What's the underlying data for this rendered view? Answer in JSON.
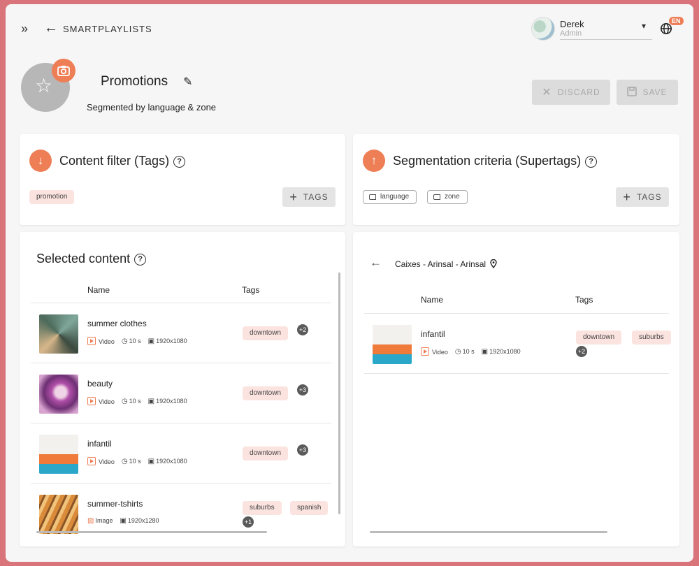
{
  "breadcrumb": "SMARTPLAYLISTS",
  "user": {
    "name": "Derek",
    "role": "Admin"
  },
  "language_badge": "EN",
  "playlist": {
    "title": "Promotions",
    "subtitle": "Segmented by language & zone"
  },
  "actions": {
    "discard": "DISCARD",
    "save": "SAVE"
  },
  "content_filter": {
    "title": "Content filter (Tags)",
    "tags": [
      "promotion"
    ],
    "add_label": "TAGS"
  },
  "segmentation": {
    "title": "Segmentation criteria (Supertags)",
    "tags": [
      "language",
      "zone"
    ],
    "add_label": "TAGS"
  },
  "selected_content": {
    "title": "Selected content",
    "columns": {
      "name": "Name",
      "tags": "Tags"
    },
    "items": [
      {
        "name": "summer clothes",
        "type": "Video",
        "duration": "10 s",
        "resolution": "1920x1080",
        "tags": [
          "downtown"
        ],
        "more": "+2"
      },
      {
        "name": "beauty",
        "type": "Video",
        "duration": "10 s",
        "resolution": "1920x1080",
        "tags": [
          "downtown"
        ],
        "more": "+3"
      },
      {
        "name": "infantil",
        "type": "Video",
        "duration": "10 s",
        "resolution": "1920x1080",
        "tags": [
          "downtown"
        ],
        "more": "+3"
      },
      {
        "name": "summer-tshirts",
        "type": "Image",
        "resolution": "1920x1280",
        "tags": [
          "suburbs",
          "spanish"
        ],
        "more": "+1"
      }
    ]
  },
  "segment_preview": {
    "location": "Caixes - Arinsal - Arinsal",
    "columns": {
      "name": "Name",
      "tags": "Tags"
    },
    "items": [
      {
        "name": "infantil",
        "type": "Video",
        "duration": "10 s",
        "resolution": "1920x1080",
        "tags": [
          "downtown",
          "suburbs"
        ],
        "more": "+2"
      }
    ]
  },
  "colors": {
    "accent": "#ee7e55",
    "tag_bg": "#fbe3df",
    "frame": "#d9747a"
  },
  "icons": [
    "expand-icon",
    "back-arrow-icon",
    "chevron-down-icon",
    "globe-icon",
    "camera-icon",
    "star-icon",
    "edit-pencil-icon",
    "close-icon",
    "save-disk-icon",
    "arrow-down-icon",
    "arrow-up-icon",
    "help-icon",
    "plus-icon",
    "tag-outline-icon",
    "video-icon",
    "clock-icon",
    "resolution-icon",
    "image-icon",
    "location-pin-icon"
  ]
}
